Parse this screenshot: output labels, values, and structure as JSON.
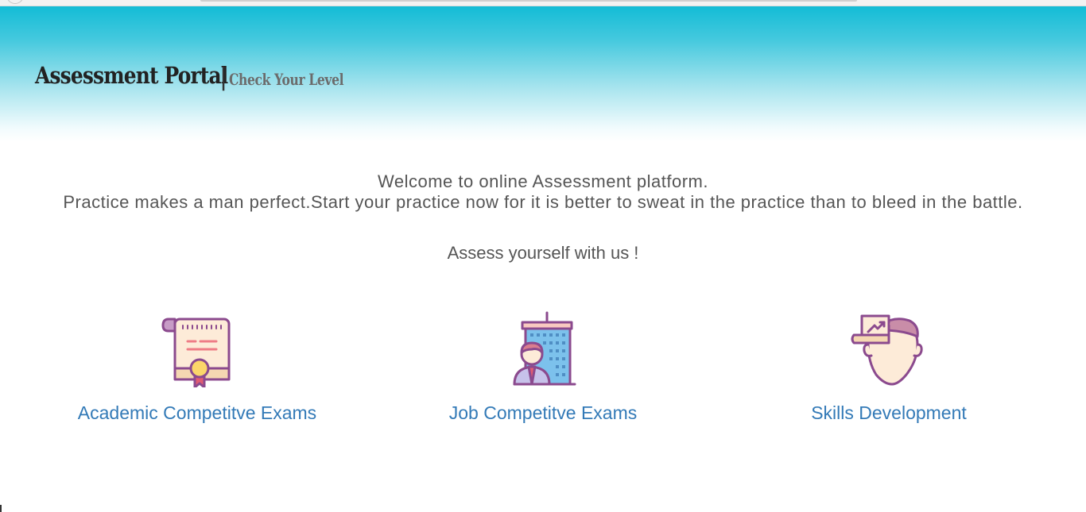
{
  "header": {
    "title": "Assessment Portal",
    "separator": "|",
    "tagline": "Check Your Level"
  },
  "intro": {
    "line1": "Welcome to online Assessment platform.",
    "line2": "Practice makes a man perfect.Start your practice now for it is better to sweat in the practice than to bleed in the battle.",
    "line3": "Assess yourself with us !"
  },
  "categories": [
    {
      "label": "Academic Competitve Exams",
      "icon": "certificate-icon"
    },
    {
      "label": "Job Competitve Exams",
      "icon": "office-worker-icon"
    },
    {
      "label": "Skills Development",
      "icon": "growth-mindset-icon"
    }
  ],
  "colors": {
    "header_gradient_top": "#13bcd6",
    "link": "#337ab7",
    "text": "#555555",
    "icon_outline": "#8b4a8e"
  }
}
